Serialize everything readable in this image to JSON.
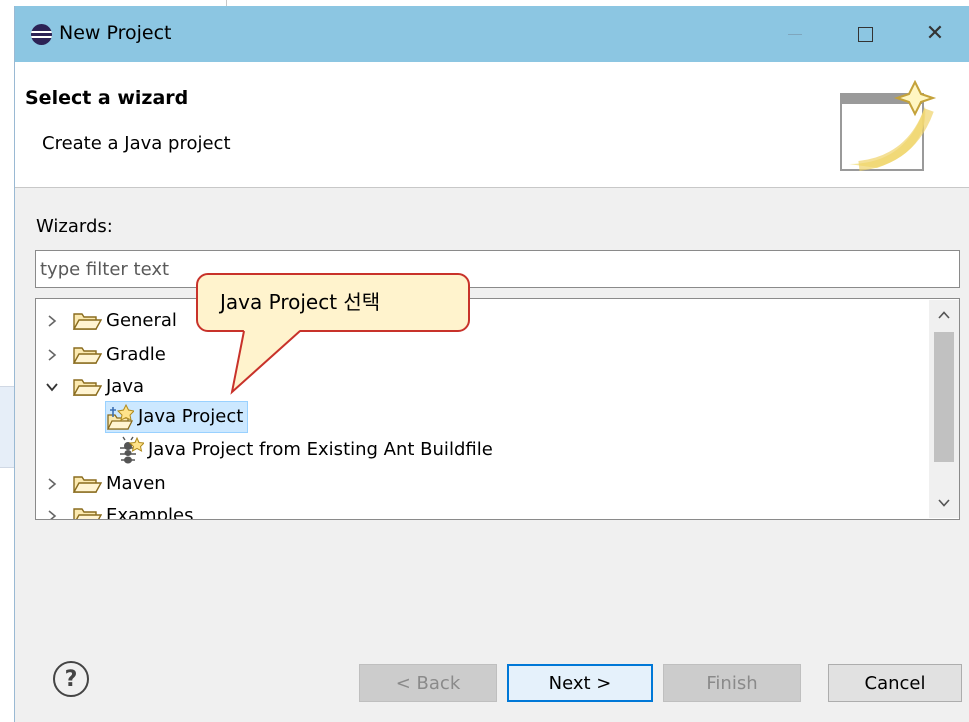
{
  "window": {
    "title": "New Project"
  },
  "header": {
    "title": "Select a wizard",
    "description": "Create a Java project"
  },
  "wizards": {
    "label": "Wizards:",
    "filter_placeholder": "type filter text",
    "tree": [
      {
        "label": "General",
        "expanded": false,
        "icon": "folder-icon"
      },
      {
        "label": "Gradle",
        "expanded": false,
        "icon": "folder-icon"
      },
      {
        "label": "Java",
        "expanded": true,
        "icon": "folder-icon",
        "children": [
          {
            "label": "Java Project",
            "selected": true,
            "icon": "java-project-icon"
          },
          {
            "label": "Java Project from Existing Ant Buildfile",
            "selected": false,
            "icon": "ant-buildfile-icon"
          }
        ]
      },
      {
        "label": "Maven",
        "expanded": false,
        "icon": "folder-icon"
      },
      {
        "label": "Examples",
        "expanded": false,
        "icon": "folder-icon"
      }
    ]
  },
  "callout": {
    "text": "Java Project 선택"
  },
  "buttons": {
    "help": "?",
    "back": "< Back",
    "next": "Next >",
    "finish": "Finish",
    "cancel": "Cancel"
  },
  "colors": {
    "titlebar": "#8cc6e2",
    "selection": "#cce8ff",
    "callout_fill": "#fff3cd",
    "callout_border": "#c8322a",
    "default_button_border": "#0078d7"
  }
}
